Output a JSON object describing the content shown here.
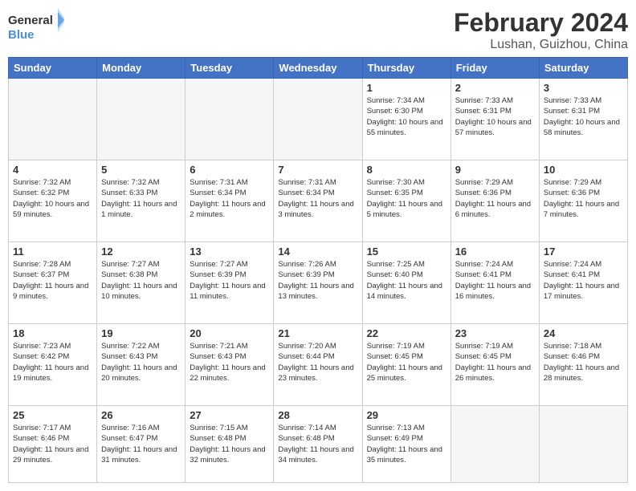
{
  "header": {
    "logo_general": "General",
    "logo_blue": "Blue",
    "title": "February 2024",
    "location": "Lushan, Guizhou, China"
  },
  "days_of_week": [
    "Sunday",
    "Monday",
    "Tuesday",
    "Wednesday",
    "Thursday",
    "Friday",
    "Saturday"
  ],
  "weeks": [
    [
      {
        "day": "",
        "info": ""
      },
      {
        "day": "",
        "info": ""
      },
      {
        "day": "",
        "info": ""
      },
      {
        "day": "",
        "info": ""
      },
      {
        "day": "1",
        "info": "Sunrise: 7:34 AM\nSunset: 6:30 PM\nDaylight: 10 hours and 55 minutes."
      },
      {
        "day": "2",
        "info": "Sunrise: 7:33 AM\nSunset: 6:31 PM\nDaylight: 10 hours and 57 minutes."
      },
      {
        "day": "3",
        "info": "Sunrise: 7:33 AM\nSunset: 6:31 PM\nDaylight: 10 hours and 58 minutes."
      }
    ],
    [
      {
        "day": "4",
        "info": "Sunrise: 7:32 AM\nSunset: 6:32 PM\nDaylight: 10 hours and 59 minutes."
      },
      {
        "day": "5",
        "info": "Sunrise: 7:32 AM\nSunset: 6:33 PM\nDaylight: 11 hours and 1 minute."
      },
      {
        "day": "6",
        "info": "Sunrise: 7:31 AM\nSunset: 6:34 PM\nDaylight: 11 hours and 2 minutes."
      },
      {
        "day": "7",
        "info": "Sunrise: 7:31 AM\nSunset: 6:34 PM\nDaylight: 11 hours and 3 minutes."
      },
      {
        "day": "8",
        "info": "Sunrise: 7:30 AM\nSunset: 6:35 PM\nDaylight: 11 hours and 5 minutes."
      },
      {
        "day": "9",
        "info": "Sunrise: 7:29 AM\nSunset: 6:36 PM\nDaylight: 11 hours and 6 minutes."
      },
      {
        "day": "10",
        "info": "Sunrise: 7:29 AM\nSunset: 6:36 PM\nDaylight: 11 hours and 7 minutes."
      }
    ],
    [
      {
        "day": "11",
        "info": "Sunrise: 7:28 AM\nSunset: 6:37 PM\nDaylight: 11 hours and 9 minutes."
      },
      {
        "day": "12",
        "info": "Sunrise: 7:27 AM\nSunset: 6:38 PM\nDaylight: 11 hours and 10 minutes."
      },
      {
        "day": "13",
        "info": "Sunrise: 7:27 AM\nSunset: 6:39 PM\nDaylight: 11 hours and 11 minutes."
      },
      {
        "day": "14",
        "info": "Sunrise: 7:26 AM\nSunset: 6:39 PM\nDaylight: 11 hours and 13 minutes."
      },
      {
        "day": "15",
        "info": "Sunrise: 7:25 AM\nSunset: 6:40 PM\nDaylight: 11 hours and 14 minutes."
      },
      {
        "day": "16",
        "info": "Sunrise: 7:24 AM\nSunset: 6:41 PM\nDaylight: 11 hours and 16 minutes."
      },
      {
        "day": "17",
        "info": "Sunrise: 7:24 AM\nSunset: 6:41 PM\nDaylight: 11 hours and 17 minutes."
      }
    ],
    [
      {
        "day": "18",
        "info": "Sunrise: 7:23 AM\nSunset: 6:42 PM\nDaylight: 11 hours and 19 minutes."
      },
      {
        "day": "19",
        "info": "Sunrise: 7:22 AM\nSunset: 6:43 PM\nDaylight: 11 hours and 20 minutes."
      },
      {
        "day": "20",
        "info": "Sunrise: 7:21 AM\nSunset: 6:43 PM\nDaylight: 11 hours and 22 minutes."
      },
      {
        "day": "21",
        "info": "Sunrise: 7:20 AM\nSunset: 6:44 PM\nDaylight: 11 hours and 23 minutes."
      },
      {
        "day": "22",
        "info": "Sunrise: 7:19 AM\nSunset: 6:45 PM\nDaylight: 11 hours and 25 minutes."
      },
      {
        "day": "23",
        "info": "Sunrise: 7:19 AM\nSunset: 6:45 PM\nDaylight: 11 hours and 26 minutes."
      },
      {
        "day": "24",
        "info": "Sunrise: 7:18 AM\nSunset: 6:46 PM\nDaylight: 11 hours and 28 minutes."
      }
    ],
    [
      {
        "day": "25",
        "info": "Sunrise: 7:17 AM\nSunset: 6:46 PM\nDaylight: 11 hours and 29 minutes."
      },
      {
        "day": "26",
        "info": "Sunrise: 7:16 AM\nSunset: 6:47 PM\nDaylight: 11 hours and 31 minutes."
      },
      {
        "day": "27",
        "info": "Sunrise: 7:15 AM\nSunset: 6:48 PM\nDaylight: 11 hours and 32 minutes."
      },
      {
        "day": "28",
        "info": "Sunrise: 7:14 AM\nSunset: 6:48 PM\nDaylight: 11 hours and 34 minutes."
      },
      {
        "day": "29",
        "info": "Sunrise: 7:13 AM\nSunset: 6:49 PM\nDaylight: 11 hours and 35 minutes."
      },
      {
        "day": "",
        "info": ""
      },
      {
        "day": "",
        "info": ""
      }
    ]
  ]
}
